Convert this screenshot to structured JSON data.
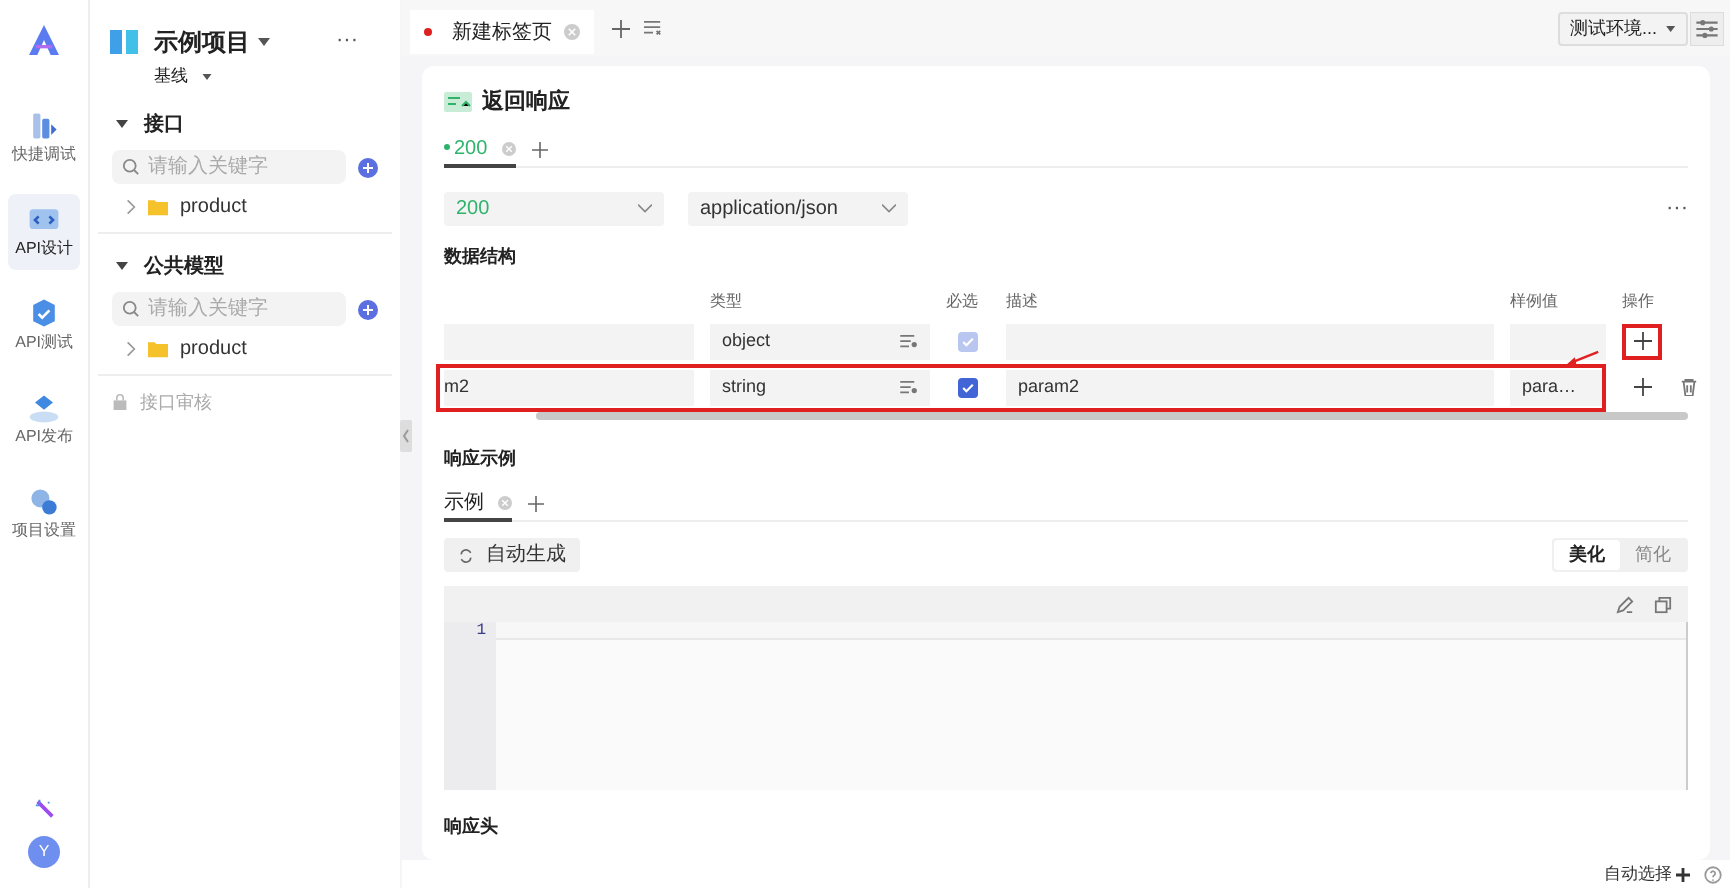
{
  "rail": {
    "items": [
      {
        "label": "快捷调试",
        "selected": false
      },
      {
        "label": "API设计",
        "selected": true
      },
      {
        "label": "API测试",
        "selected": false
      },
      {
        "label": "API发布",
        "selected": false
      },
      {
        "label": "项目设置",
        "selected": false
      }
    ],
    "avatar": "Y"
  },
  "sidebar": {
    "project": "示例项目",
    "branch": "基线",
    "more": "···",
    "sections": [
      {
        "title": "接口",
        "expanded": true,
        "search_placeholder": "请输入关键字",
        "children": [
          {
            "label": "product",
            "expanded": false
          }
        ]
      },
      {
        "title": "公共模型",
        "expanded": true,
        "search_placeholder": "请输入关键字",
        "children": [
          {
            "label": "product",
            "expanded": false
          }
        ]
      }
    ],
    "review": {
      "label": "接口审核",
      "disabled": true
    }
  },
  "tabs": [
    {
      "label": "新建标签页",
      "selected": true,
      "unsaved": true
    }
  ],
  "environment": "测试环境...",
  "panel": {
    "title": "返回响应",
    "response_tabs": [
      {
        "label": "200",
        "selected": true
      }
    ],
    "status_select": "200",
    "content_type_select": "application/json",
    "more": "···",
    "schema_title": "数据结构",
    "columns": [
      "",
      "类型",
      "必选",
      "描述",
      "样例值",
      "操作"
    ],
    "rows": [
      {
        "name": "",
        "type": "object",
        "required": true,
        "required_disabled": true,
        "description": "",
        "example": "",
        "highlighted": false,
        "add_highlighted": true,
        "deletable": false
      },
      {
        "name": "m2",
        "type": "string",
        "required": true,
        "required_disabled": false,
        "description": "param2",
        "example": "para…",
        "highlighted": true,
        "add_highlighted": false,
        "deletable": true
      }
    ],
    "example_title": "响应示例",
    "example_tabs": [
      {
        "label": "示例",
        "selected": true
      }
    ],
    "auto_generate": "自动生成",
    "format_modes": [
      {
        "label": "美化",
        "selected": true
      },
      {
        "label": "简化",
        "selected": false
      }
    ],
    "editor_lines": [
      "1"
    ],
    "headers_title": "响应头"
  },
  "footer": {
    "auto_select": "自动选择"
  }
}
